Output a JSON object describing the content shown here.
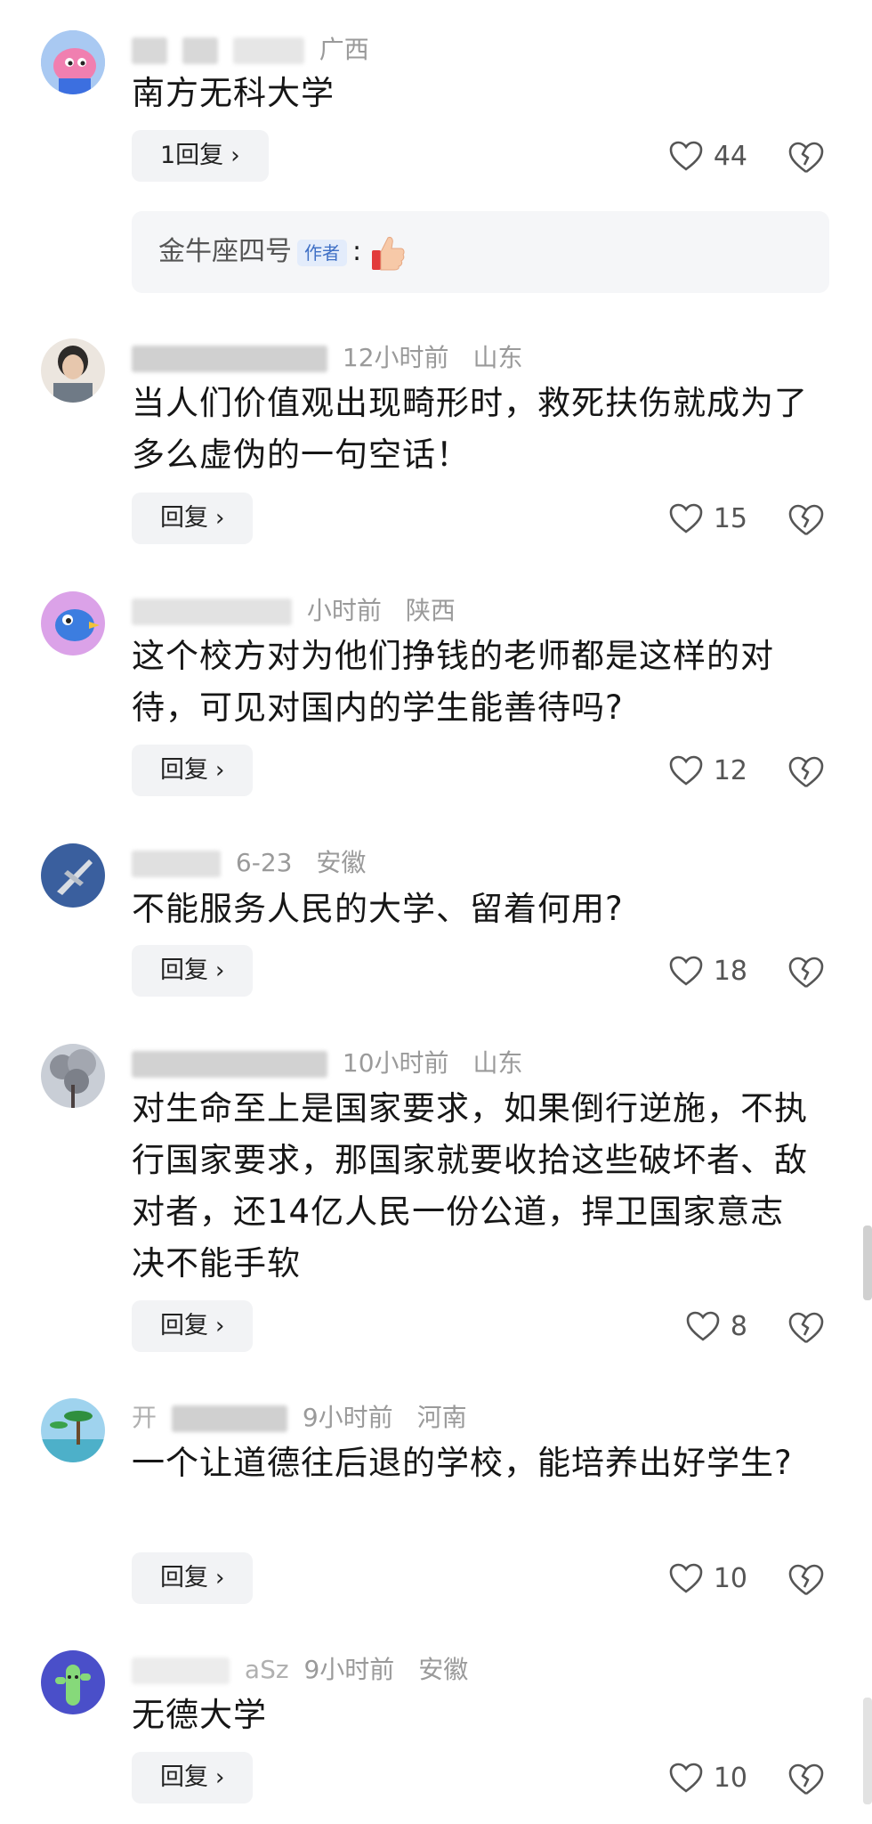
{
  "comments": [
    {
      "name": "",
      "time": "",
      "location": "广西",
      "text": "南方无科大学",
      "reply_label": "1回复",
      "likes": "44",
      "author_reply": {
        "author": "金牛座四号",
        "badge": "作者",
        "colon": ":"
      },
      "avatar_icon": "pink-cartoon-avatar-icon"
    },
    {
      "name": "",
      "time": "12小时前",
      "location": "山东",
      "text": "当人们价值观出现畸形时，救死扶伤就成为了多么虚伪的一句空话！",
      "reply_label": "回复",
      "likes": "15",
      "avatar_icon": "person-photo-avatar-icon"
    },
    {
      "name": "",
      "time": "小时前",
      "location": "陕西",
      "text": "这个校方对为他们挣钱的老师都是这样的对待，可见对国内的学生能善待吗?",
      "reply_label": "回复",
      "likes": "12",
      "avatar_icon": "cartoon-bird-avatar-icon"
    },
    {
      "name": "",
      "time": "6-23",
      "location": "安徽",
      "text": "不能服务人民的大学、留着何用?",
      "reply_label": "回复",
      "likes": "18",
      "avatar_icon": "jet-fighter-avatar-icon"
    },
    {
      "name": "",
      "time": "10小时前",
      "location": "山东",
      "text": "对生命至上是国家要求，如果倒行逆施，不执行国家要求，那国家就要收拾这些破坏者、敌对者，还14亿人民一份公道，捍卫国家意志决不能手软",
      "reply_label": "回复",
      "likes": "8",
      "avatar_icon": "tree-photo-avatar-icon"
    },
    {
      "name": "开",
      "time": "9小时前",
      "location": "河南",
      "text": "一个让道德往后退的学校，能培养出好学生?",
      "reply_label": "回复",
      "likes": "10",
      "avatar_icon": "beach-palm-avatar-icon"
    },
    {
      "name": "aSz",
      "time": "9小时前",
      "location": "安徽",
      "text": "无德大学",
      "reply_label": "回复",
      "likes": "10",
      "avatar_icon": "cactus-avatar-icon"
    }
  ],
  "icons": {
    "like": "heart-outline-icon",
    "dislike": "broken-heart-icon",
    "chevron": "›"
  }
}
